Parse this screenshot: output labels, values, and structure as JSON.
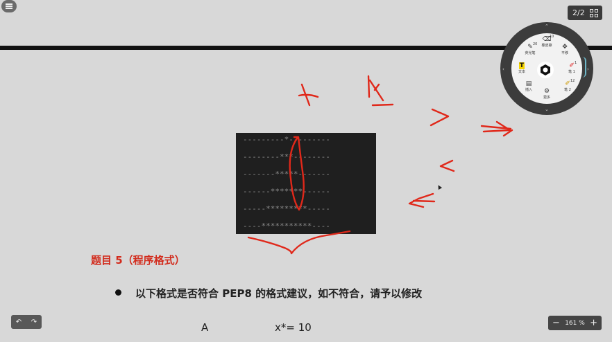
{
  "toolbar": {
    "menu_icon": "hamburger-icon",
    "page_counter": "2/2"
  },
  "slide": {
    "code_lines": [
      "---------*---------",
      "--------***--------",
      "-------*****-------",
      "------*******------",
      "-----*********-----",
      "----***********----"
    ],
    "section_title": "题目 5（程序格式）",
    "question": "以下格式是否符合 PEP8 的格式建议，如不符合，请予以修改",
    "option_a_label": "A",
    "option_a_code": "x*= 10"
  },
  "wheel": {
    "center_icon": "hexagon-gear-icon",
    "tools": [
      {
        "label": "荧光笔",
        "icon": "highlighter-icon",
        "num": "20"
      },
      {
        "label": "橡皮擦",
        "icon": "eraser-icon",
        "num": "10"
      },
      {
        "label": "平移",
        "icon": "move-icon",
        "num": ""
      },
      {
        "label": "笔 1",
        "icon": "pen-icon",
        "num": "1"
      },
      {
        "label": "笔 2",
        "icon": "pen-icon",
        "num": "12"
      },
      {
        "label": "更多",
        "icon": "sliders-icon",
        "num": ""
      },
      {
        "label": "插入",
        "icon": "insert-file-icon",
        "num": ""
      },
      {
        "label": "文本",
        "icon": "text-icon",
        "num": ""
      }
    ],
    "accent": "#6fb7c8"
  },
  "bottom": {
    "undo_icon": "undo-icon",
    "redo_icon": "redo-icon",
    "zoom_minus": "−",
    "zoom_level": "161 %",
    "zoom_plus": "+"
  },
  "colors": {
    "ink": "#e0281a",
    "title": "#d22b1c",
    "background": "#d8d8d8"
  }
}
